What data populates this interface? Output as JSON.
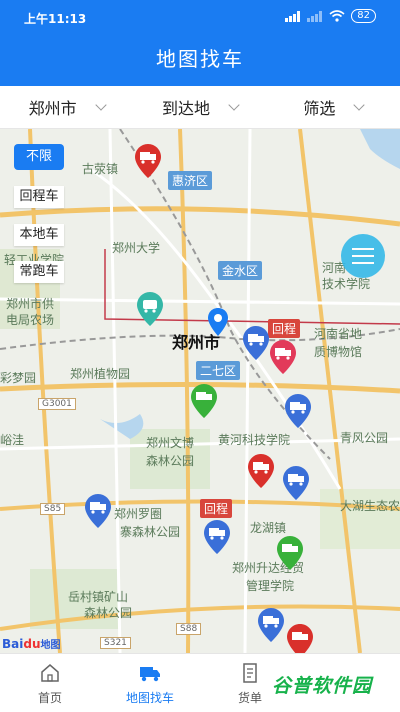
{
  "status": {
    "time": "上午11:13",
    "battery": "82"
  },
  "title": "地图找车",
  "filters": [
    {
      "label": "郑州市"
    },
    {
      "label": "到达地"
    },
    {
      "label": "筛选"
    }
  ],
  "vehicle_filter": {
    "unlimited": "不限",
    "options": [
      "回程车",
      "本地车",
      "常跑车"
    ]
  },
  "map": {
    "city_label": "郑州市",
    "districts": [
      "惠济区",
      "金水区",
      "二七区"
    ],
    "route_tags": [
      "回程",
      "回程"
    ],
    "places": [
      "古荥镇",
      "郑州大学",
      "河南",
      "技术学院",
      "河南省地",
      "质博物馆",
      "郑州市供",
      "电局农场",
      "郑州植物园",
      "彩梦园",
      "郑州文博",
      "森林公园",
      "黄河科技学院",
      "青风公园",
      "峪洼",
      "郑州罗圈",
      "寨森林公园",
      "大湖生态农业",
      "龙湖镇",
      "郑州升达经贸",
      "管理学院",
      "岳村镇矿山",
      "森林公园",
      "轻工业学院"
    ],
    "roads": [
      "G3001",
      "S85",
      "S88",
      "S321"
    ],
    "attribution": {
      "brand": "Bai",
      "brand_accent": "du",
      "suffix": "地图"
    }
  },
  "tabs": [
    {
      "label": "首页",
      "icon": "home-icon"
    },
    {
      "label": "地图找车",
      "icon": "truck-icon"
    },
    {
      "label": "货单",
      "icon": "document-icon"
    }
  ],
  "watermark": "谷普软件园",
  "colors": {
    "primary": "#1a7cf2",
    "truck_pin": "#3a6fd8",
    "cargo_pin": "#d9302b",
    "green_pin": "#38b13a",
    "teal_pin": "#34b7a7"
  }
}
